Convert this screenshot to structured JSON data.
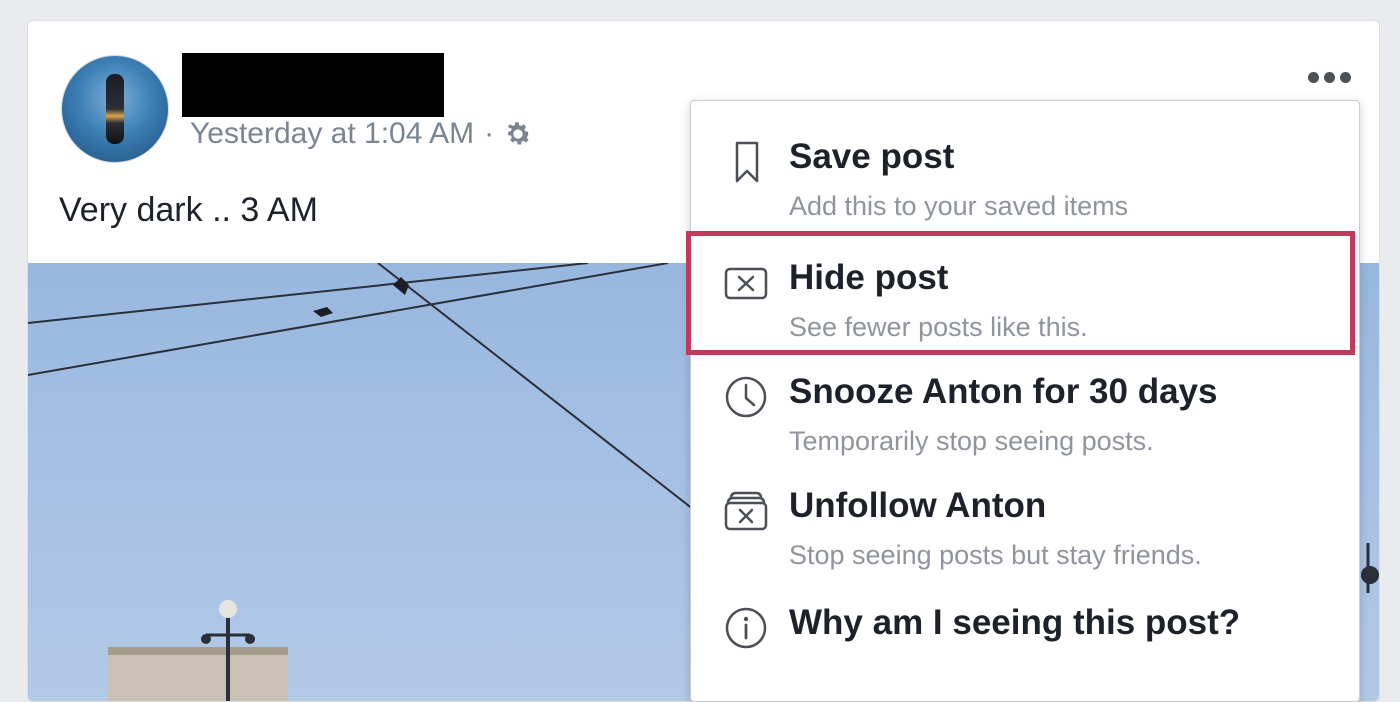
{
  "post": {
    "timestamp": "Yesterday at 1:04 AM",
    "separator": "·",
    "text": "Very dark .. 3 AM"
  },
  "menu": {
    "items": [
      {
        "title": "Save post",
        "subtitle": "Add this to your saved items",
        "icon": "bookmark-icon"
      },
      {
        "title": "Hide post",
        "subtitle": "See fewer posts like this.",
        "icon": "hide-box-icon"
      },
      {
        "title": "Snooze Anton for 30 days",
        "subtitle": "Temporarily stop seeing posts.",
        "icon": "clock-icon"
      },
      {
        "title": "Unfollow Anton",
        "subtitle": "Stop seeing posts but stay friends.",
        "icon": "unfollow-stack-icon"
      },
      {
        "title": "Why am I seeing this post?",
        "icon": "info-icon"
      }
    ]
  },
  "colors": {
    "highlight": "#c13a5c",
    "menu_title": "#1d2129",
    "menu_subtitle": "#90949c"
  }
}
